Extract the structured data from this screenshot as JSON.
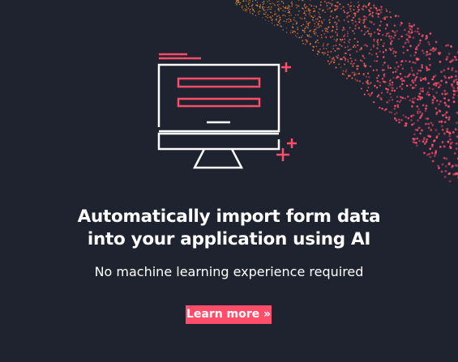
{
  "headline": {
    "line1": "Automatically import form data",
    "line2": "into your application using AI"
  },
  "subtitle": "No machine learning experience required",
  "cta": {
    "label": "Learn more »"
  },
  "colors": {
    "background": "#1f2330",
    "accent": "#ff4d6a",
    "particles_start": "#f5a623",
    "particles_end": "#ff4d6a"
  },
  "illustration": {
    "icon": "monitor-with-form-icon"
  }
}
